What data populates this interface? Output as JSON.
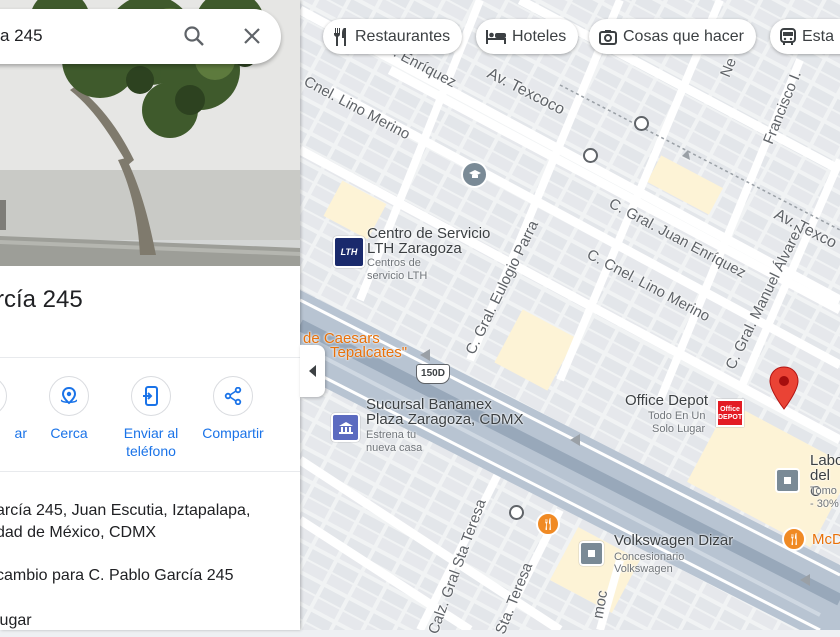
{
  "search": {
    "value": "a 245"
  },
  "chips": [
    {
      "label": "Restaurantes",
      "icon": "restaurant-icon"
    },
    {
      "label": "Hoteles",
      "icon": "hotel-icon"
    },
    {
      "label": "Cosas que hacer",
      "icon": "camera-icon"
    },
    {
      "label": "Esta",
      "icon": "transit-icon"
    }
  ],
  "place": {
    "title": "rcía 245",
    "actions": [
      {
        "label": "ar",
        "icon": "directions-icon"
      },
      {
        "label": "Cerca",
        "icon": "nearby-icon"
      },
      {
        "label": "Enviar al",
        "label2": "teléfono",
        "icon": "send-to-phone-icon"
      },
      {
        "label": "Compartir",
        "icon": "share-icon"
      }
    ],
    "address_line1": "arcía 245, Juan Escutia, Iztapalapa,",
    "address_line2": "dad de México, CDMX",
    "suggest": "cambio para C. Pablo García 245",
    "add_place": "lugar"
  },
  "map": {
    "streets": {
      "texcoco1": "Av. Texcoco",
      "texcoco2": "Av. Texco",
      "lino_merino1": "Cnel. Lino Merino",
      "lino_merino2": "C. Cnel. Lino Merino",
      "enriquez1": "C. Enríquez",
      "enriquez2": "C. Gral. Juan Enríquez",
      "eulogio": "C. Gral. Eulogio Parra",
      "manuel": "C. Gral. Manuel Álvarez",
      "francisco": "Francisco I.",
      "ne": "Ne",
      "sta_teresa1": "Calz. Gral Sta Teresa",
      "sta_teresa2": "Sta. Teresa",
      "moc": "moc",
      "route": "150D"
    },
    "pois": {
      "lth_title1": "Centro de Servicio",
      "lth_title2": "LTH Zaragoza",
      "lth_sub1": "Centros de",
      "lth_sub2": "servicio LTH",
      "caesars1": "de Caesars",
      "caesars2": "Tepalcates\"",
      "banamex1": "Sucursal Banamex",
      "banamex2": "Plaza Zaragoza, CDMX",
      "banamex_sub1": "Estrena tu",
      "banamex_sub2": "nueva casa",
      "office_title": "Office Depot",
      "office_sub1": "Todo En Un",
      "office_sub2": "Solo Lugar",
      "vw_title": "Volkswagen Dizar",
      "vw_sub1": "Concesionario",
      "vw_sub2": "Volkswagen",
      "labo1": "Labo",
      "labo2": "del C",
      "labo3": "Tomo",
      "labo4": "- 30%",
      "mcd": "McD"
    }
  },
  "colors": {
    "accent": "#1a73e8",
    "pin": "#ea4335",
    "road": "#ffffff",
    "block": "#e8eaed",
    "highway": "#aab7c6"
  }
}
